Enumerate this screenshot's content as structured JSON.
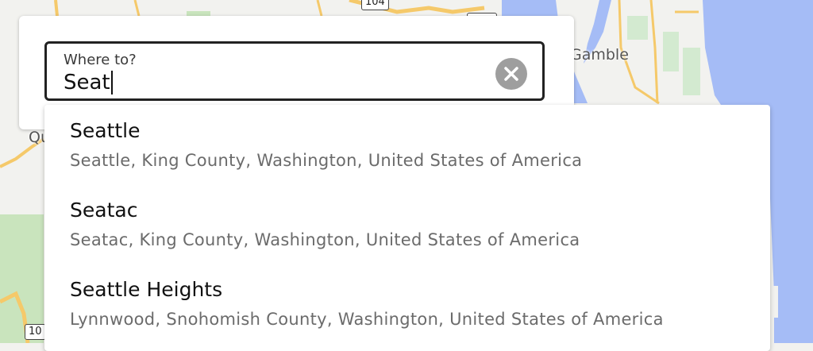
{
  "map": {
    "labels": {
      "gamble": "Gamble",
      "quilcene_fragment": "Qu"
    },
    "shields": {
      "route_top": "104",
      "route_bottom": "10"
    },
    "colors": {
      "water": "#a5bcf6",
      "land": "#f2f2ef",
      "park": "#c9e4bd",
      "road": "#f5c96a"
    }
  },
  "search": {
    "label": "Where to?",
    "value": "Seat",
    "clear_icon": "close-circle-icon"
  },
  "suggestions": [
    {
      "name": "Seattle",
      "detail": "Seattle, King County, Washington, United States of America"
    },
    {
      "name": "Seatac",
      "detail": "Seatac, King County, Washington, United States of America"
    },
    {
      "name": "Seattle Heights",
      "detail": "Lynnwood, Snohomish County, Washington, United States of America"
    }
  ]
}
